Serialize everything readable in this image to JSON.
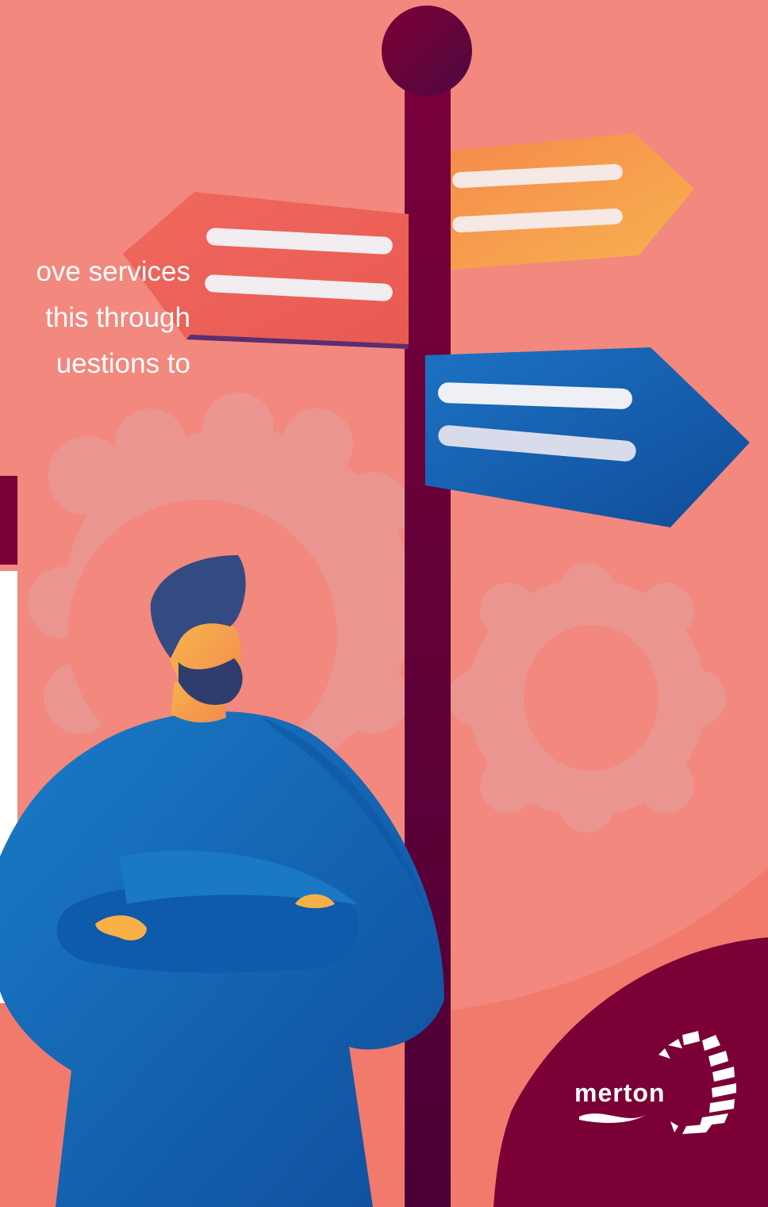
{
  "intro": {
    "lines": [
      "ove services",
      "this through",
      "uestions to"
    ]
  },
  "logo": {
    "text": "merton"
  },
  "colors": {
    "background": "#f27a6d",
    "background_circle": "#f2887e",
    "post": "#6b0033",
    "sign_red": "#ee6157",
    "sign_orange": "#f5a04e",
    "sign_blue": "#1565b5",
    "shirt": "#1565b5",
    "hair": "#2e3d6e",
    "skin": "#f7b048",
    "logo_blob": "#7a0035"
  },
  "icons": [
    "gear-icon",
    "signpost-icon",
    "person-illustration",
    "merton-logo"
  ]
}
